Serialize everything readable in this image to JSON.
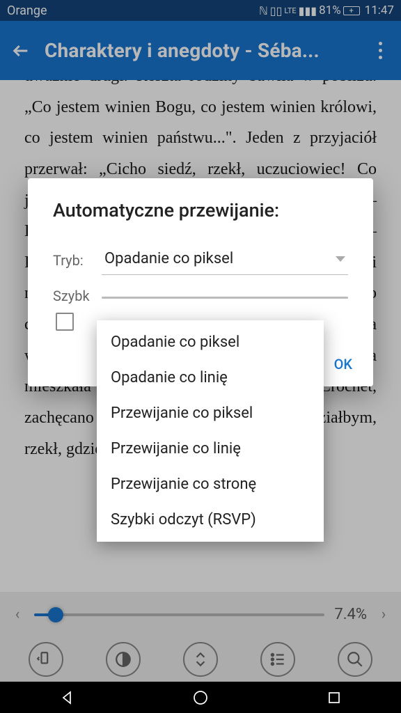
{
  "status": {
    "carrier": "Orange",
    "battery": "81%",
    "time": "11:47"
  },
  "header": {
    "title": "Charaktery i anegdoty - Séba..."
  },
  "reader": {
    "text": "uważnie drugi. Reszta rodziny bawiła w pobliżu. „Co jestem winien Bogu, co jestem winien królowi, co jestem winien państwu...\". Jeden z przyjaciół przerwał: „Cicho siedź, rzekł, uczuciowiec! Co jestem winien Bogu? Nic. Pogodziłem się z nim. — Królowi? Nie więcej, syn mój w jego służbie. — Państwu? Tyle co nic. Rodzinie? Pogodziliśmy się i nienawidzimy się jak krewni; niech sobie robią co chcą\". Zarzucono mu, że niemoralność wprowadza w dom zapraszając kobietę złych obyczajów, która mieszkała u niego i nazywała się panna Crochet, zachęcano go do wydalenia jej. „Nie wiedziałbym, rzekł, gdzie spędzać wieczory\"."
  },
  "dialog": {
    "title": "Automatyczne przewijanie:",
    "mode_label": "Tryb:",
    "mode_value": "Opadanie co piksel",
    "speed_label": "Szybk",
    "ok": "OK",
    "options": [
      "Opadanie co piksel",
      "Opadanie co linię",
      "Przewijanie co piksel",
      "Przewijanie co linię",
      "Przewijanie co stronę",
      "Szybki odczyt (RSVP)"
    ]
  },
  "progress": {
    "percent": "7.4%"
  }
}
